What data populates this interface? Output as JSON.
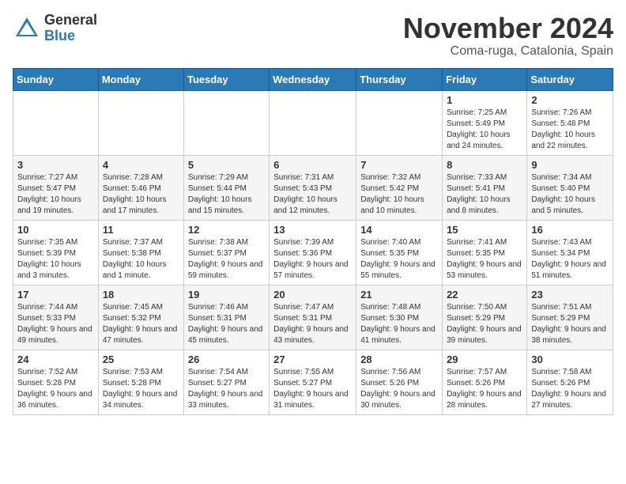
{
  "header": {
    "logo_general": "General",
    "logo_blue": "Blue",
    "month_title": "November 2024",
    "location": "Coma-ruga, Catalonia, Spain"
  },
  "days_of_week": [
    "Sunday",
    "Monday",
    "Tuesday",
    "Wednesday",
    "Thursday",
    "Friday",
    "Saturday"
  ],
  "weeks": [
    [
      {
        "day": "",
        "info": ""
      },
      {
        "day": "",
        "info": ""
      },
      {
        "day": "",
        "info": ""
      },
      {
        "day": "",
        "info": ""
      },
      {
        "day": "",
        "info": ""
      },
      {
        "day": "1",
        "info": "Sunrise: 7:25 AM\nSunset: 5:49 PM\nDaylight: 10 hours and 24 minutes."
      },
      {
        "day": "2",
        "info": "Sunrise: 7:26 AM\nSunset: 5:48 PM\nDaylight: 10 hours and 22 minutes."
      }
    ],
    [
      {
        "day": "3",
        "info": "Sunrise: 7:27 AM\nSunset: 5:47 PM\nDaylight: 10 hours and 19 minutes."
      },
      {
        "day": "4",
        "info": "Sunrise: 7:28 AM\nSunset: 5:46 PM\nDaylight: 10 hours and 17 minutes."
      },
      {
        "day": "5",
        "info": "Sunrise: 7:29 AM\nSunset: 5:44 PM\nDaylight: 10 hours and 15 minutes."
      },
      {
        "day": "6",
        "info": "Sunrise: 7:31 AM\nSunset: 5:43 PM\nDaylight: 10 hours and 12 minutes."
      },
      {
        "day": "7",
        "info": "Sunrise: 7:32 AM\nSunset: 5:42 PM\nDaylight: 10 hours and 10 minutes."
      },
      {
        "day": "8",
        "info": "Sunrise: 7:33 AM\nSunset: 5:41 PM\nDaylight: 10 hours and 8 minutes."
      },
      {
        "day": "9",
        "info": "Sunrise: 7:34 AM\nSunset: 5:40 PM\nDaylight: 10 hours and 5 minutes."
      }
    ],
    [
      {
        "day": "10",
        "info": "Sunrise: 7:35 AM\nSunset: 5:39 PM\nDaylight: 10 hours and 3 minutes."
      },
      {
        "day": "11",
        "info": "Sunrise: 7:37 AM\nSunset: 5:38 PM\nDaylight: 10 hours and 1 minute."
      },
      {
        "day": "12",
        "info": "Sunrise: 7:38 AM\nSunset: 5:37 PM\nDaylight: 9 hours and 59 minutes."
      },
      {
        "day": "13",
        "info": "Sunrise: 7:39 AM\nSunset: 5:36 PM\nDaylight: 9 hours and 57 minutes."
      },
      {
        "day": "14",
        "info": "Sunrise: 7:40 AM\nSunset: 5:35 PM\nDaylight: 9 hours and 55 minutes."
      },
      {
        "day": "15",
        "info": "Sunrise: 7:41 AM\nSunset: 5:35 PM\nDaylight: 9 hours and 53 minutes."
      },
      {
        "day": "16",
        "info": "Sunrise: 7:43 AM\nSunset: 5:34 PM\nDaylight: 9 hours and 51 minutes."
      }
    ],
    [
      {
        "day": "17",
        "info": "Sunrise: 7:44 AM\nSunset: 5:33 PM\nDaylight: 9 hours and 49 minutes."
      },
      {
        "day": "18",
        "info": "Sunrise: 7:45 AM\nSunset: 5:32 PM\nDaylight: 9 hours and 47 minutes."
      },
      {
        "day": "19",
        "info": "Sunrise: 7:46 AM\nSunset: 5:31 PM\nDaylight: 9 hours and 45 minutes."
      },
      {
        "day": "20",
        "info": "Sunrise: 7:47 AM\nSunset: 5:31 PM\nDaylight: 9 hours and 43 minutes."
      },
      {
        "day": "21",
        "info": "Sunrise: 7:48 AM\nSunset: 5:30 PM\nDaylight: 9 hours and 41 minutes."
      },
      {
        "day": "22",
        "info": "Sunrise: 7:50 AM\nSunset: 5:29 PM\nDaylight: 9 hours and 39 minutes."
      },
      {
        "day": "23",
        "info": "Sunrise: 7:51 AM\nSunset: 5:29 PM\nDaylight: 9 hours and 38 minutes."
      }
    ],
    [
      {
        "day": "24",
        "info": "Sunrise: 7:52 AM\nSunset: 5:28 PM\nDaylight: 9 hours and 36 minutes."
      },
      {
        "day": "25",
        "info": "Sunrise: 7:53 AM\nSunset: 5:28 PM\nDaylight: 9 hours and 34 minutes."
      },
      {
        "day": "26",
        "info": "Sunrise: 7:54 AM\nSunset: 5:27 PM\nDaylight: 9 hours and 33 minutes."
      },
      {
        "day": "27",
        "info": "Sunrise: 7:55 AM\nSunset: 5:27 PM\nDaylight: 9 hours and 31 minutes."
      },
      {
        "day": "28",
        "info": "Sunrise: 7:56 AM\nSunset: 5:26 PM\nDaylight: 9 hours and 30 minutes."
      },
      {
        "day": "29",
        "info": "Sunrise: 7:57 AM\nSunset: 5:26 PM\nDaylight: 9 hours and 28 minutes."
      },
      {
        "day": "30",
        "info": "Sunrise: 7:58 AM\nSunset: 5:26 PM\nDaylight: 9 hours and 27 minutes."
      }
    ]
  ]
}
